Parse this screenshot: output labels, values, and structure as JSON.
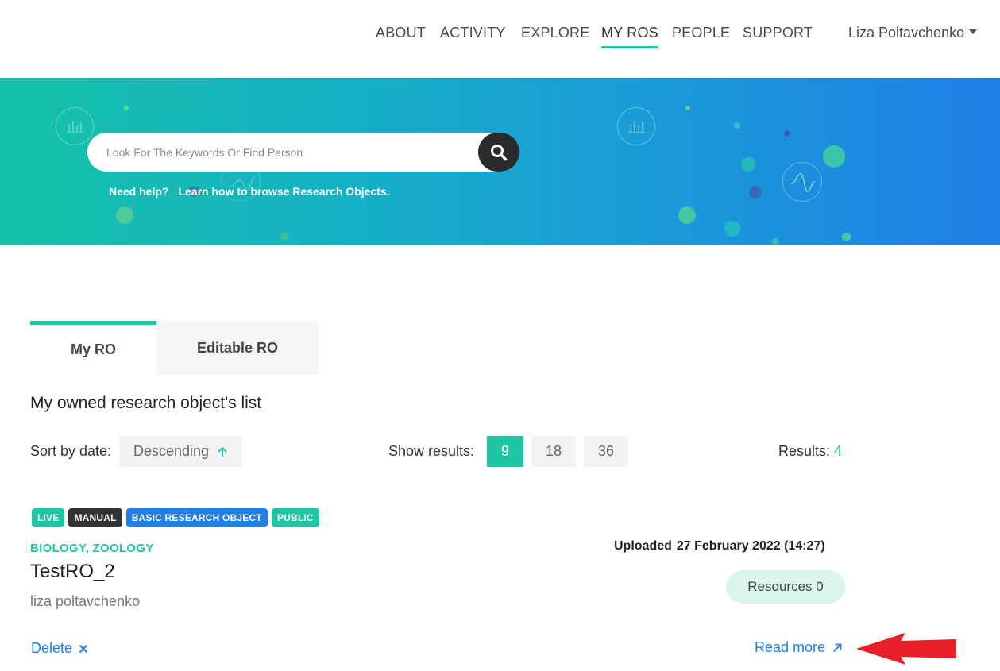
{
  "nav": {
    "items": [
      {
        "label": "ABOUT"
      },
      {
        "label": "ACTIVITY"
      },
      {
        "label": "EXPLORE"
      },
      {
        "label": "MY ROS"
      },
      {
        "label": "PEOPLE"
      },
      {
        "label": "SUPPORT"
      }
    ],
    "active": "MY ROS",
    "user_name": "Liza Poltavchenko"
  },
  "hero": {
    "search_placeholder": "Look For The Keywords Or Find Person",
    "search_value": "",
    "help_prefix": "Need help?",
    "help_link": "Learn how to browse Research Objects."
  },
  "tabs": [
    {
      "label": "My RO",
      "active": true
    },
    {
      "label": "Editable RO",
      "active": false
    }
  ],
  "section_title": "My owned research object's list",
  "controls": {
    "sort_label": "Sort by date:",
    "sort_value": "Descending",
    "show_label": "Show results:",
    "page_sizes": [
      "9",
      "18",
      "36"
    ],
    "page_size_active": "9",
    "results_label": "Results:",
    "results_count": "4"
  },
  "ro": {
    "badges": [
      "LIVE",
      "MANUAL",
      "BASIC RESEARCH OBJECT",
      "PUBLIC"
    ],
    "disciplines": "BIOLOGY, ZOOLOGY",
    "title": "TestRO_2",
    "author": "liza poltavchenko",
    "uploaded_label": "Uploaded",
    "uploaded_date": "27 February 2022 (14:27)",
    "resources": "Resources 0",
    "delete_label": "Delete",
    "read_more_label": "Read more"
  },
  "colors": {
    "accent": "#1fc6a3",
    "link": "#1e7fe6",
    "annotation_arrow": "#e8202a"
  }
}
